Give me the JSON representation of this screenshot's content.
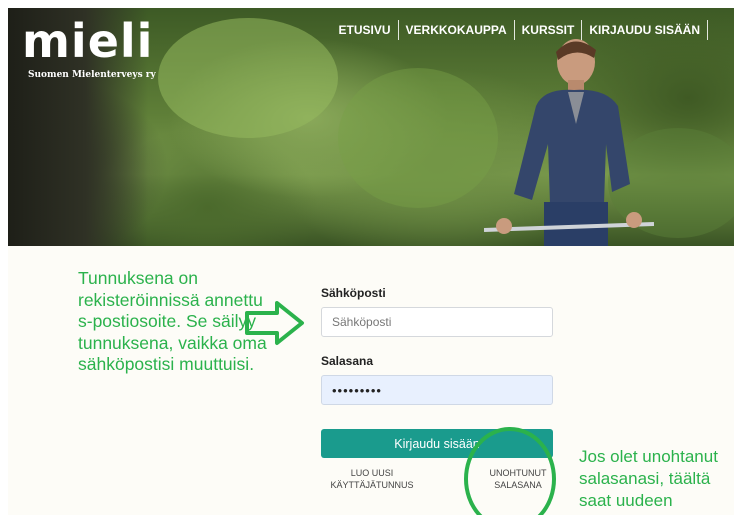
{
  "brand": {
    "logo": "mieli",
    "subtitle": "Suomen Mielenterveys ry"
  },
  "nav": {
    "items": [
      {
        "label": "ETUSIVU"
      },
      {
        "label": "VERKKOKAUPPA"
      },
      {
        "label": "KURSSIT"
      },
      {
        "label": "KIRJAUDU SISÄÄN"
      }
    ]
  },
  "login": {
    "email_label": "Sähköposti",
    "email_placeholder": "Sähköposti",
    "password_label": "Salasana",
    "password_value": "•••••••••",
    "submit_label": "Kirjaudu sisään",
    "create_account_label": "LUO UUSI KÄYTTÄJÄTUNNUS",
    "forgot_password_label": "UNOHTUNUT SALASANA"
  },
  "annotations": {
    "left_note": "Tunnuksena on rekisteröinnissä annettu s-postiosoite. Se säilyy tunnuksena, vaikka oma sähköpostisi muuttuisi.",
    "right_note": "Jos olet unohtanut salasanasi, täältä saat uudeen",
    "color": "#2bb24c"
  },
  "colors": {
    "button": "#1a9b8d",
    "password_bg": "#e8f0fe"
  }
}
